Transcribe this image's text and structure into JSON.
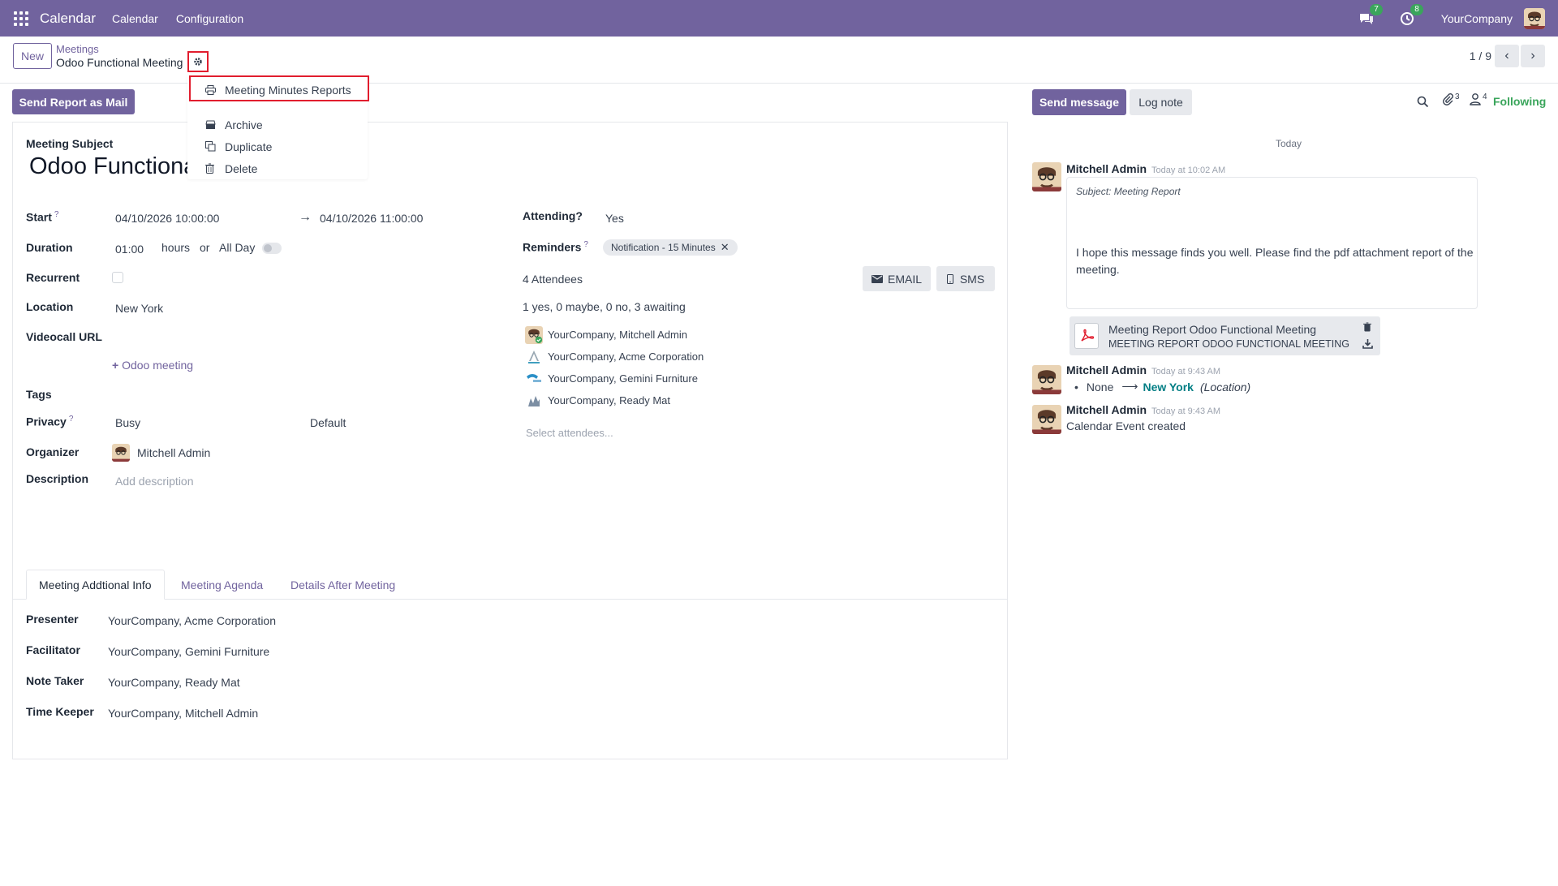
{
  "topbar": {
    "app_name": "Calendar",
    "menu": [
      "Calendar",
      "Configuration"
    ],
    "messages_count": "7",
    "activities_count": "8",
    "company": "YourCompany"
  },
  "control_panel": {
    "new_label": "New",
    "breadcrumb_parent": "Meetings",
    "breadcrumb_current": "Odoo Functional Meeting",
    "pager": "1 / 9"
  },
  "gear_menu": {
    "items": [
      {
        "label": "Meeting Minutes Reports",
        "icon": "print-icon"
      },
      {
        "label": "Archive",
        "icon": "archive-icon"
      },
      {
        "label": "Duplicate",
        "icon": "copy-icon"
      },
      {
        "label": "Delete",
        "icon": "trash-icon"
      }
    ]
  },
  "actions": {
    "send_report": "Send Report as Mail"
  },
  "form": {
    "subject_label": "Meeting Subject",
    "subject_value": "Odoo Functional Meeting",
    "start_label": "Start",
    "start_value": "04/10/2026 10:00:00",
    "stop_value": "04/10/2026 11:00:00",
    "duration_label": "Duration",
    "duration_value": "01:00",
    "hours_text": "hours",
    "or_text": "or",
    "allday_label": "All Day",
    "recurrent_label": "Recurrent",
    "location_label": "Location",
    "location_value": "New York",
    "videocall_label": "Videocall URL",
    "odoo_meeting": "Odoo meeting",
    "tags_label": "Tags",
    "privacy_label": "Privacy",
    "privacy_value": "Busy",
    "privacy_default": "Default",
    "organizer_label": "Organizer",
    "organizer_value": "Mitchell Admin",
    "description_label": "Description",
    "description_placeholder": "Add description",
    "attending_label": "Attending?",
    "attending_value": "Yes",
    "reminders_label": "Reminders",
    "reminder_tag": "Notification - 15 Minutes",
    "attendees_count": "4 Attendees",
    "email_btn": "EMAIL",
    "sms_btn": "SMS",
    "attendees_summary": "1 yes, 0 maybe, 0 no, 3 awaiting",
    "attendees": [
      "YourCompany, Mitchell Admin",
      "YourCompany, Acme Corporation",
      "YourCompany, Gemini Furniture",
      "YourCompany, Ready Mat"
    ],
    "attendees_placeholder": "Select attendees..."
  },
  "tabs": [
    "Meeting Addtional Info",
    "Meeting Agenda",
    "Details After Meeting"
  ],
  "info": {
    "presenter_label": "Presenter",
    "presenter_value": "YourCompany, Acme Corporation",
    "facilitator_label": "Facilitator",
    "facilitator_value": "YourCompany, Gemini Furniture",
    "note_taker_label": "Note Taker",
    "note_taker_value": "YourCompany, Ready Mat",
    "time_keeper_label": "Time Keeper",
    "time_keeper_value": "YourCompany, Mitchell Admin"
  },
  "chatter": {
    "send_message": "Send message",
    "log_note": "Log note",
    "attachments_count": "3",
    "followers_count": "4",
    "following": "Following",
    "date_separator": "Today",
    "messages": [
      {
        "author": "Mitchell Admin",
        "time": "Today at 10:02 AM",
        "subject": "Subject: Meeting Report",
        "body": "I hope this message finds you well. Please find the pdf attachment report of the meeting.",
        "attachment_name": "Meeting Report Odoo Functional Meeting",
        "attachment_sub": "MEETING REPORT ODOO FUNCTIONAL MEETING"
      },
      {
        "author": "Mitchell Admin",
        "time": "Today at 9:43 AM",
        "old_value": "None",
        "new_value": "New York",
        "field": "(Location)"
      },
      {
        "author": "Mitchell Admin",
        "time": "Today at 9:43 AM",
        "body": "Calendar Event created"
      }
    ]
  },
  "colors": {
    "brand": "#71639e",
    "highlight": "#e11d2e",
    "following": "#3aa55b"
  }
}
